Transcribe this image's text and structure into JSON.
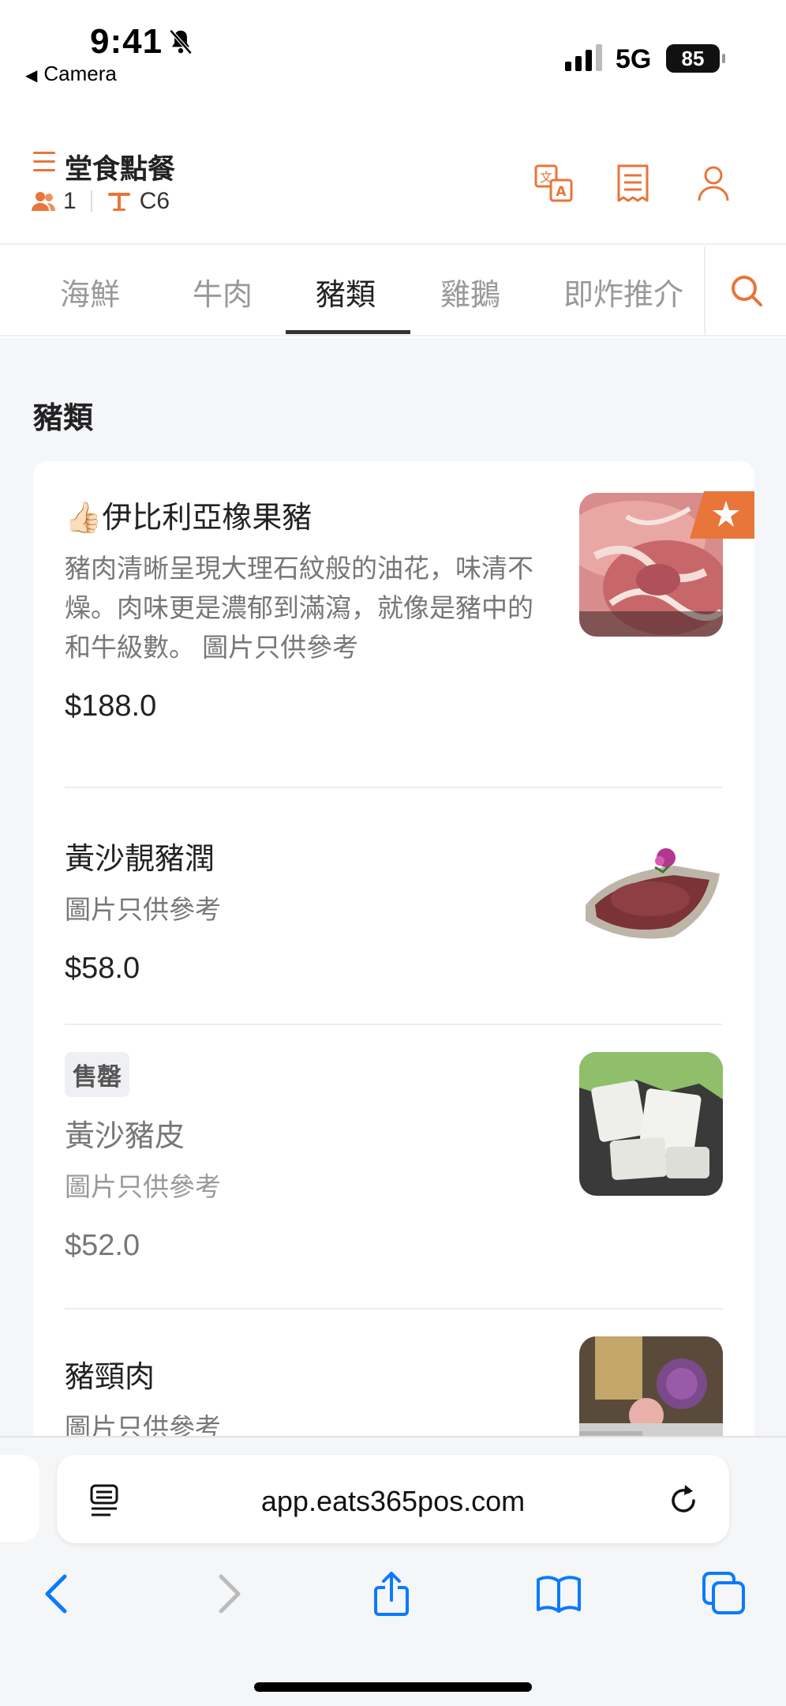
{
  "status_bar": {
    "time": "9:41",
    "back_app": "Camera",
    "network": "5G",
    "battery": "85"
  },
  "header": {
    "title": "堂食點餐",
    "guests": "1",
    "table": "C6"
  },
  "tabs": [
    {
      "label": "海鮮",
      "active": false
    },
    {
      "label": "牛肉",
      "active": false
    },
    {
      "label": "豬類",
      "active": true
    },
    {
      "label": "雞鵝",
      "active": false
    },
    {
      "label": "即炸推介",
      "active": false
    }
  ],
  "section": {
    "title": "豬類"
  },
  "items": [
    {
      "emoji": "👍🏻",
      "name": "伊比利亞橡果豬",
      "desc": "豬肉清晰呈現大理石紋般的油花，味清不燥。肉味更是濃郁到滿瀉，就像是豬中的和牛級數。 圖片只供參考",
      "price": "$188.0"
    },
    {
      "name": "黃沙靚豬潤",
      "desc": "圖片只供參考",
      "price": "$58.0"
    },
    {
      "badge": "售罄",
      "name": "黃沙豬皮",
      "desc": "圖片只供參考",
      "price": "$52.0"
    },
    {
      "name": "豬頸肉",
      "desc": "圖片只供參考"
    }
  ],
  "browser": {
    "url": "app.eats365pos.com"
  },
  "colors": {
    "accent": "#e8753a",
    "ios_blue": "#0a7aff"
  }
}
